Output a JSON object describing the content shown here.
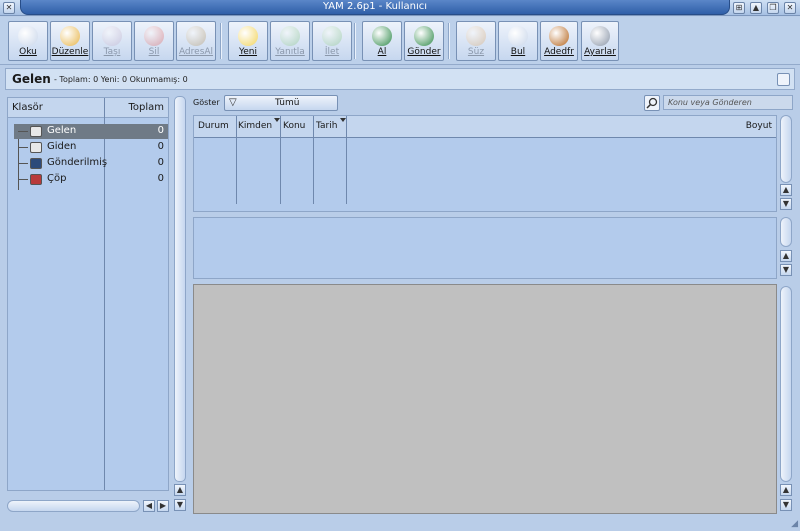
{
  "window": {
    "title": "YAM 2.6p1 - Kullanıcı",
    "close_glyph": "✕",
    "buttons": [
      "⊞",
      "▲",
      "❐",
      "✕"
    ]
  },
  "toolbar": {
    "buttons": [
      {
        "label": "Oku",
        "icon": "magnifier-icon",
        "color": "#c9d6ea",
        "enabled": true
      },
      {
        "label": "Düzenle",
        "icon": "pencil-icon",
        "color": "#e7b54a",
        "enabled": true
      },
      {
        "label": "Taşı",
        "icon": "move-icon",
        "color": "#b9a7c6",
        "enabled": false
      },
      {
        "label": "Sil",
        "icon": "trash-icon",
        "color": "#d75a5a",
        "enabled": false
      },
      {
        "label": "AdresAl",
        "icon": "address-icon",
        "color": "#a98c5b",
        "enabled": false
      },
      {
        "label": "Yeni",
        "icon": "new-mail-icon",
        "color": "#f2d45c",
        "enabled": true
      },
      {
        "label": "Yanıtla",
        "icon": "reply-icon",
        "color": "#7fbf7f",
        "enabled": false
      },
      {
        "label": "İlet",
        "icon": "forward-icon",
        "color": "#7fbf7f",
        "enabled": false
      },
      {
        "label": "Al",
        "icon": "get-mail-globe-icon",
        "color": "#2f8a4a",
        "enabled": true
      },
      {
        "label": "Gönder",
        "icon": "send-mail-globe-icon",
        "color": "#2f8a4a",
        "enabled": true
      },
      {
        "label": "Süz",
        "icon": "filter-funnel-icon",
        "color": "#d4a36b",
        "enabled": false
      },
      {
        "label": "Bul",
        "icon": "find-icon",
        "color": "#c9d6ea",
        "enabled": true
      },
      {
        "label": "Adedfr",
        "icon": "address-book-icon",
        "color": "#b5651d",
        "enabled": true
      },
      {
        "label": "Ayarlar",
        "icon": "settings-icon",
        "color": "#8a96a8",
        "enabled": true
      }
    ]
  },
  "folder_info": {
    "name": "Gelen",
    "stats": "- Toplam: 0 Yeni: 0 Okunmamış: 0"
  },
  "folders": {
    "header_name": "Klasör",
    "header_total": "Toplam",
    "items": [
      {
        "label": "Gelen",
        "count": "0",
        "icon": "inbox-icon",
        "color": "#e8e8e8"
      },
      {
        "label": "Giden",
        "count": "0",
        "icon": "outbox-icon",
        "color": "#e8e8e8"
      },
      {
        "label": "Gönderilmiş",
        "count": "0",
        "icon": "sent-icon",
        "color": "#2c4a7a"
      },
      {
        "label": "Çöp",
        "count": "0",
        "icon": "trash-icon",
        "color": "#b83a3a"
      }
    ]
  },
  "filter": {
    "label": "Göster",
    "selected": "Tümü",
    "search_placeholder": "Konu veya Gönderen"
  },
  "message_list": {
    "columns": [
      "Durum",
      "Kimden",
      "Konu",
      "Tarih",
      "Boyut"
    ]
  },
  "colors": {
    "accent": "#2f5fa8",
    "panel": "#b3cbec",
    "selection": "#6f7a86"
  }
}
